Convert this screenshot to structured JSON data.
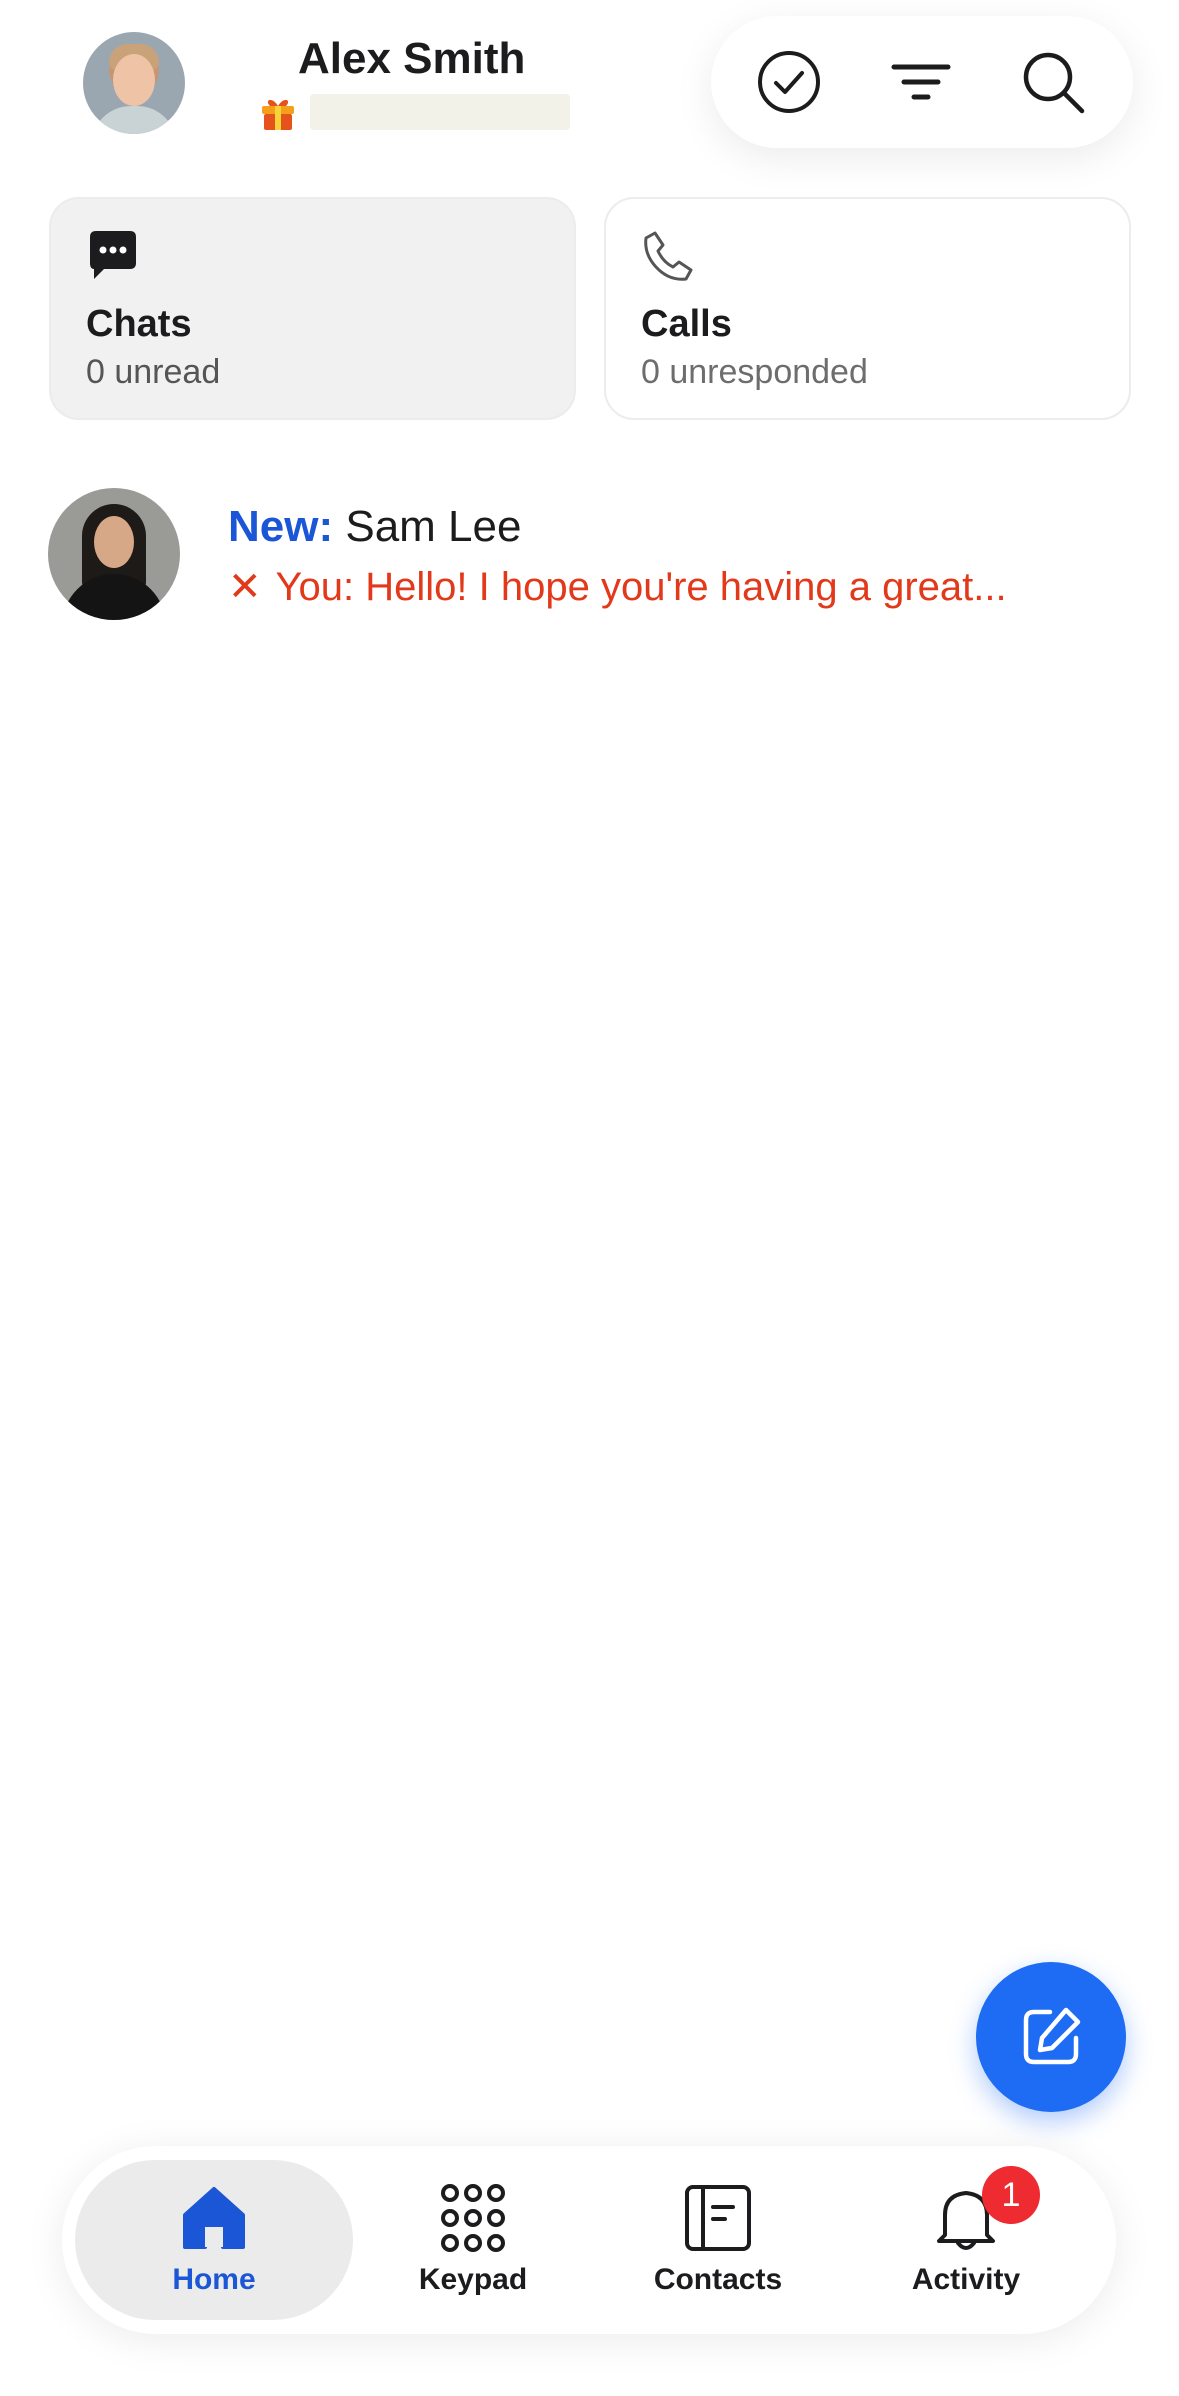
{
  "header": {
    "user_name": "Alex Smith"
  },
  "cards": {
    "chats": {
      "title": "Chats",
      "subtitle": "0 unread"
    },
    "calls": {
      "title": "Calls",
      "subtitle": "0 unresponded"
    }
  },
  "conversation": {
    "new_label": "New:",
    "contact_name": "Sam Lee",
    "preview_prefix": "✕",
    "preview_text": "You: Hello! I hope you're having a great..."
  },
  "nav": {
    "items": [
      {
        "label": "Home",
        "icon": "home-icon",
        "active": true
      },
      {
        "label": "Keypad",
        "icon": "keypad-icon",
        "active": false
      },
      {
        "label": "Contacts",
        "icon": "contacts-icon",
        "active": false
      },
      {
        "label": "Activity",
        "icon": "bell-icon",
        "active": false
      }
    ],
    "activity_badge": "1"
  },
  "colors": {
    "accent": "#1e6bf4",
    "new_label": "#1a56d6",
    "failed_message": "#e2391b",
    "badge": "#ee2b30"
  }
}
